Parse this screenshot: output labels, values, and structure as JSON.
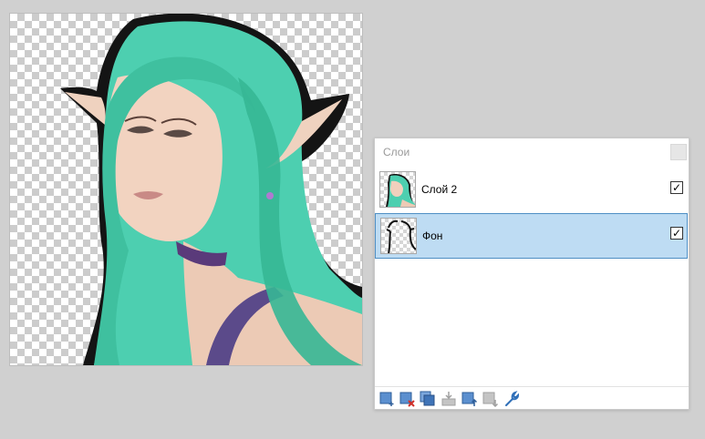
{
  "panel": {
    "title": "Слои",
    "layers": [
      {
        "name": "Слой 2",
        "visible": true,
        "selected": false,
        "thumbnail": "elf-portrait"
      },
      {
        "name": "Фон",
        "visible": true,
        "selected": true,
        "thumbnail": "elf-outline"
      }
    ],
    "check_glyph": "✓",
    "toolbar": [
      "add-layer-icon",
      "delete-layer-icon",
      "duplicate-layer-icon",
      "merge-layer-down-icon",
      "move-layer-up-icon",
      "move-layer-down-icon",
      "layer-properties-wrench-icon"
    ]
  },
  "colors": {
    "selection_bg": "#bedcf3",
    "selection_border": "#4f8fc4",
    "hair": "#4dcfb0",
    "outline": "#111111",
    "skin": "#f1d0bd"
  }
}
